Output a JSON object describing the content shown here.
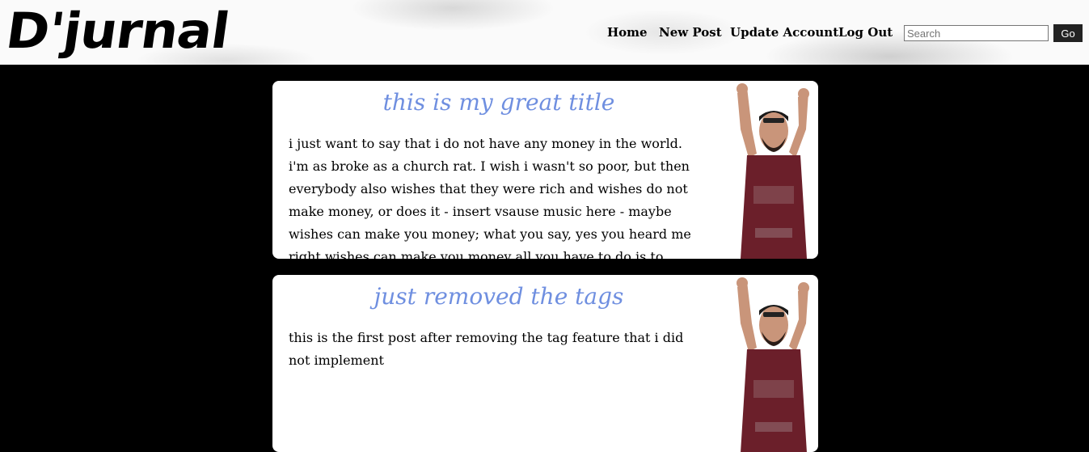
{
  "header": {
    "logo": "D'jurnal",
    "nav": [
      {
        "label": "Home"
      },
      {
        "label": "New Post"
      },
      {
        "label": "Update Account"
      },
      {
        "label": "Log Out"
      }
    ],
    "search": {
      "placeholder": "Search",
      "value": ""
    },
    "go_label": "Go"
  },
  "posts": [
    {
      "title": "this is my great title",
      "body": "i just want to say that i do not have any money in the world. i'm as broke as a church rat. I wish i wasn't so poor, but then everybody also wishes that they were rich and wishes do not make money, or does it - insert vsause music here - maybe wishes can make you money; what you say, yes you heard me right wishes can make you money all you have to do is to break all the mirrors in your house - if you have no mirror in your house then i'm"
    },
    {
      "title": "just removed the tags",
      "body": "this is the first post after removing the tag feature that i did not implement"
    }
  ],
  "colors": {
    "title": "#6f8fe0",
    "shirt": "#6b1f2a",
    "background": "#000000"
  }
}
